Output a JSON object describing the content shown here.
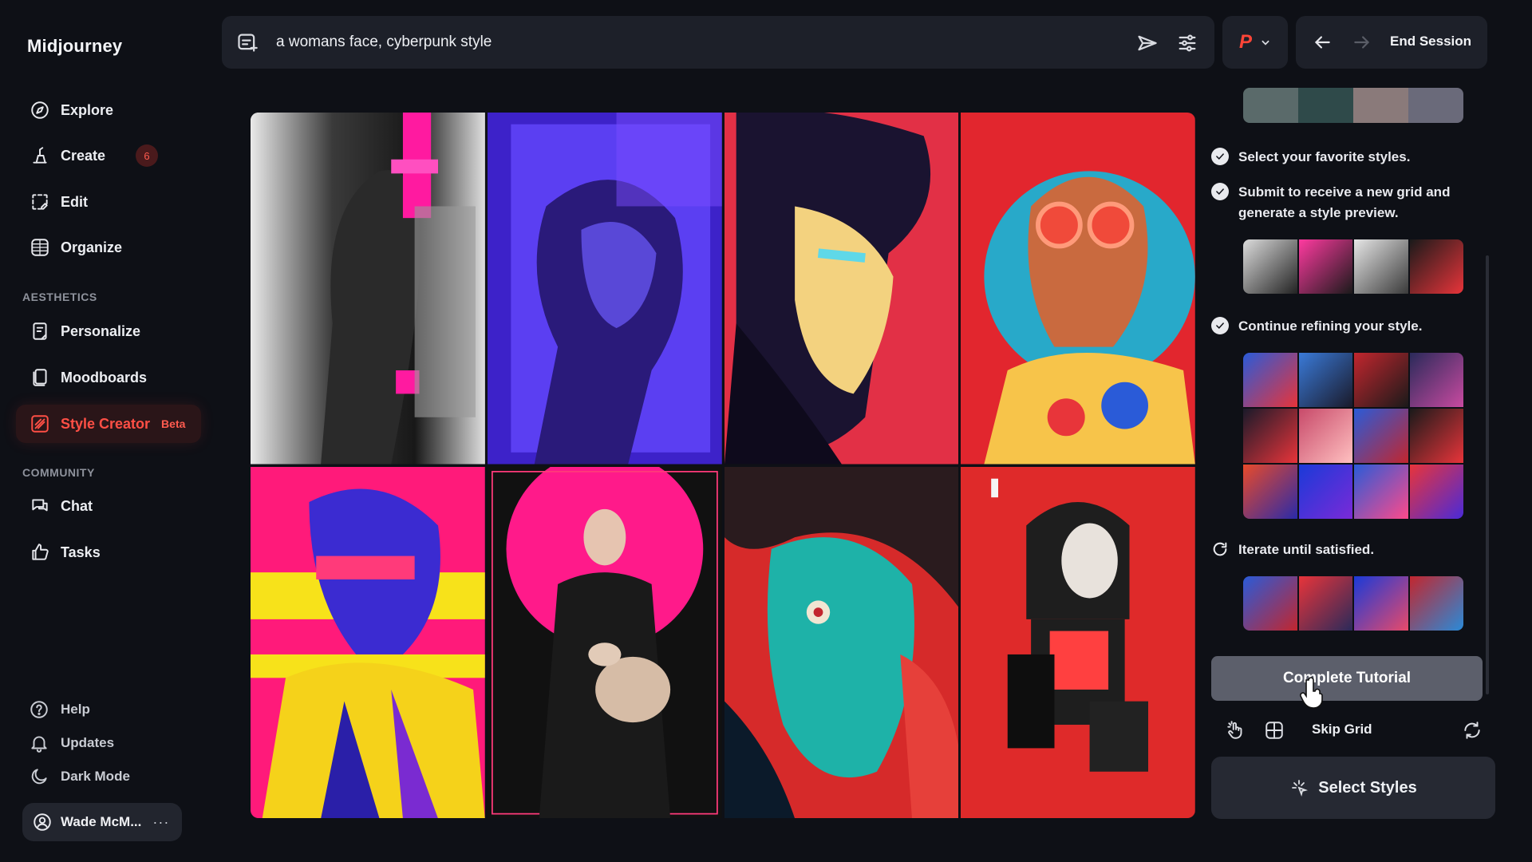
{
  "app": {
    "brand": "Midjourney"
  },
  "sidebar": {
    "nav": [
      {
        "label": "Explore",
        "icon": "compass-icon"
      },
      {
        "label": "Create",
        "icon": "brush-icon",
        "badge": "6"
      },
      {
        "label": "Edit",
        "icon": "edit-frame-icon"
      },
      {
        "label": "Organize",
        "icon": "grid-icon"
      }
    ],
    "aesthetics_label": "AESTHETICS",
    "aesthetics": [
      {
        "label": "Personalize",
        "icon": "personalize-icon"
      },
      {
        "label": "Moodboards",
        "icon": "moodboard-icon"
      },
      {
        "label": "Style Creator",
        "icon": "style-creator-icon",
        "tag": "Beta",
        "active": true
      }
    ],
    "community_label": "COMMUNITY",
    "community": [
      {
        "label": "Chat",
        "icon": "chat-icon"
      },
      {
        "label": "Tasks",
        "icon": "thumbs-up-icon"
      }
    ],
    "bottom": [
      {
        "label": "Help",
        "icon": "help-icon"
      },
      {
        "label": "Updates",
        "icon": "bell-icon"
      },
      {
        "label": "Dark Mode",
        "icon": "moon-icon"
      }
    ],
    "user": {
      "name": "Wade McM...",
      "more": "···"
    }
  },
  "topbar": {
    "prompt": "a womans face, cyberpunk style",
    "profile_letter": "P",
    "end_session": "End Session"
  },
  "grid": {
    "tiles": [
      {
        "name": "grayscale-glitch-portrait",
        "colors": [
          "#e8e8e8",
          "#1a1a1a",
          "#ff1aa0"
        ]
      },
      {
        "name": "violet-sculpted-face",
        "colors": [
          "#2b1a8a",
          "#5a3ff0",
          "#1a0f4a"
        ]
      },
      {
        "name": "anime-red-hero",
        "colors": [
          "#e03030",
          "#f2d27a",
          "#1b1430"
        ]
      },
      {
        "name": "sunglasses-teal-circle",
        "colors": [
          "#e2262e",
          "#27a7c7",
          "#f08a3a"
        ]
      },
      {
        "name": "magenta-sunglasses-man",
        "colors": [
          "#ff1a7a",
          "#f7e21a",
          "#3b2bd1"
        ]
      },
      {
        "name": "woman-with-lamb",
        "colors": [
          "#ff1a8a",
          "#111111",
          "#d8b9a0"
        ]
      },
      {
        "name": "teal-face-red-splash",
        "colors": [
          "#d82a2a",
          "#1fb0a8",
          "#0b1a2a"
        ]
      },
      {
        "name": "red-woman-collage",
        "colors": [
          "#e02a2a",
          "#222222",
          "#f0f0f0"
        ]
      }
    ]
  },
  "panel": {
    "steps": [
      {
        "text": "Select your favorite styles.",
        "icon": "check-circle-icon"
      },
      {
        "text": "Submit to receive a new grid and generate a style preview.",
        "icon": "check-circle-icon"
      },
      {
        "text": "Continue refining your style.",
        "icon": "check-circle-icon"
      },
      {
        "text": "Iterate until satisfied.",
        "icon": "refresh-icon"
      }
    ],
    "complete_button": "Complete Tutorial",
    "skip_grid": "Skip Grid",
    "select_styles": "Select Styles"
  }
}
